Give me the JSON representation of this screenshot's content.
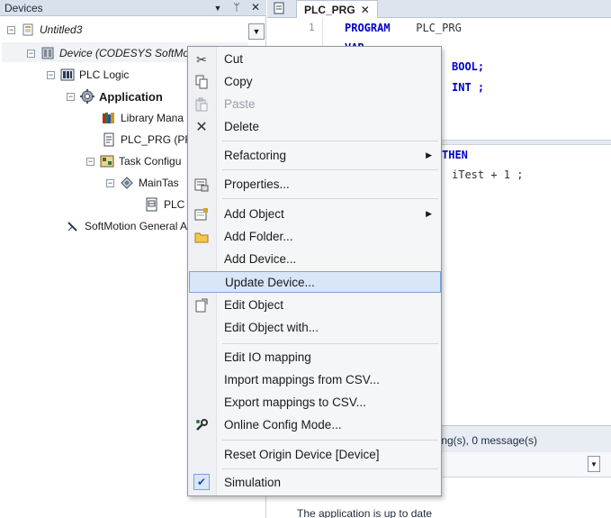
{
  "devices_panel": {
    "title": "Devices",
    "buttons": {
      "dropdown": "▼",
      "pin": "ᛘ",
      "close": "✕"
    },
    "tree": [
      {
        "label": "Untitled3",
        "expander": "−",
        "icon": "project-icon",
        "style": "italic"
      },
      {
        "label": "Device (CODESYS SoftMo",
        "expander": "−",
        "icon": "device-icon",
        "style": "italic"
      },
      {
        "label": "PLC Logic",
        "expander": "−",
        "icon": "plc-logic-icon",
        "style": "normal"
      },
      {
        "label": "Application",
        "expander": "−",
        "icon": "application-gear-icon",
        "style": "bold"
      },
      {
        "label": "Library Mana",
        "expander": "",
        "icon": "library-books-icon",
        "style": "normal"
      },
      {
        "label": "PLC_PRG (PR",
        "expander": "",
        "icon": "program-page-icon",
        "style": "normal"
      },
      {
        "label": "Task Configu",
        "expander": "−",
        "icon": "task-config-icon",
        "style": "normal"
      },
      {
        "label": "MainTas",
        "expander": "−",
        "icon": "task-icon",
        "style": "normal"
      },
      {
        "label": "PLC",
        "expander": "",
        "icon": "program-call-icon",
        "style": "normal"
      },
      {
        "label": "SoftMotion General A",
        "expander": "",
        "icon": "softmotion-icon",
        "style": "normal"
      }
    ]
  },
  "editor": {
    "tab_label": "PLC_PRG",
    "tab_close": "✕",
    "top_lines": [
      {
        "num": "1",
        "kw": "PROGRAM",
        "rest": " PLC_PRG"
      },
      {
        "num": "",
        "kw": "VAR",
        "rest": ""
      }
    ],
    "decl_types": [
      {
        "type": "BOOL;"
      },
      {
        "type": "INT ;"
      }
    ],
    "body_keyword": "THEN",
    "body_text": "iTest + 1 ;",
    "messages_text": "rning(s), 0 message(s)",
    "status_text": "The application is up to date"
  },
  "context_menu": {
    "items": [
      {
        "label": "Cut",
        "icon": "scissors-icon",
        "disabled": false,
        "submenu": false
      },
      {
        "label": "Copy",
        "icon": "copy-icon",
        "disabled": false,
        "submenu": false
      },
      {
        "label": "Paste",
        "icon": "paste-icon",
        "disabled": true,
        "submenu": false
      },
      {
        "label": "Delete",
        "icon": "delete-x-icon",
        "disabled": false,
        "submenu": false
      },
      {
        "label": "Refactoring",
        "icon": "",
        "disabled": false,
        "submenu": true
      },
      {
        "label": "Properties...",
        "icon": "properties-icon",
        "disabled": false,
        "submenu": false
      },
      {
        "label": "Add Object",
        "icon": "add-object-icon",
        "disabled": false,
        "submenu": true
      },
      {
        "label": "Add Folder...",
        "icon": "folder-icon",
        "disabled": false,
        "submenu": false
      },
      {
        "label": "Add Device...",
        "icon": "",
        "disabled": false,
        "submenu": false
      },
      {
        "label": "Update Device...",
        "icon": "",
        "disabled": false,
        "submenu": false,
        "highlighted": true
      },
      {
        "label": "Edit Object",
        "icon": "edit-object-icon",
        "disabled": false,
        "submenu": false
      },
      {
        "label": "Edit Object with...",
        "icon": "",
        "disabled": false,
        "submenu": false
      },
      {
        "label": "Edit IO mapping",
        "icon": "",
        "disabled": false,
        "submenu": false
      },
      {
        "label": "Import mappings from CSV...",
        "icon": "",
        "disabled": false,
        "submenu": false
      },
      {
        "label": "Export mappings to CSV...",
        "icon": "",
        "disabled": false,
        "submenu": false
      },
      {
        "label": "Online Config Mode...",
        "icon": "wrench-icon",
        "disabled": false,
        "submenu": false
      },
      {
        "label": "Reset Origin Device [Device]",
        "icon": "",
        "disabled": false,
        "submenu": false
      },
      {
        "label": "Simulation",
        "icon": "checkmark-icon",
        "disabled": false,
        "submenu": false,
        "checked": true
      }
    ]
  },
  "colors": {
    "keyword": "#0000c8",
    "highlight_bg": "#d8e6f8",
    "highlight_border": "#7ba4d8",
    "disabled_text": "#9aa0a8"
  }
}
